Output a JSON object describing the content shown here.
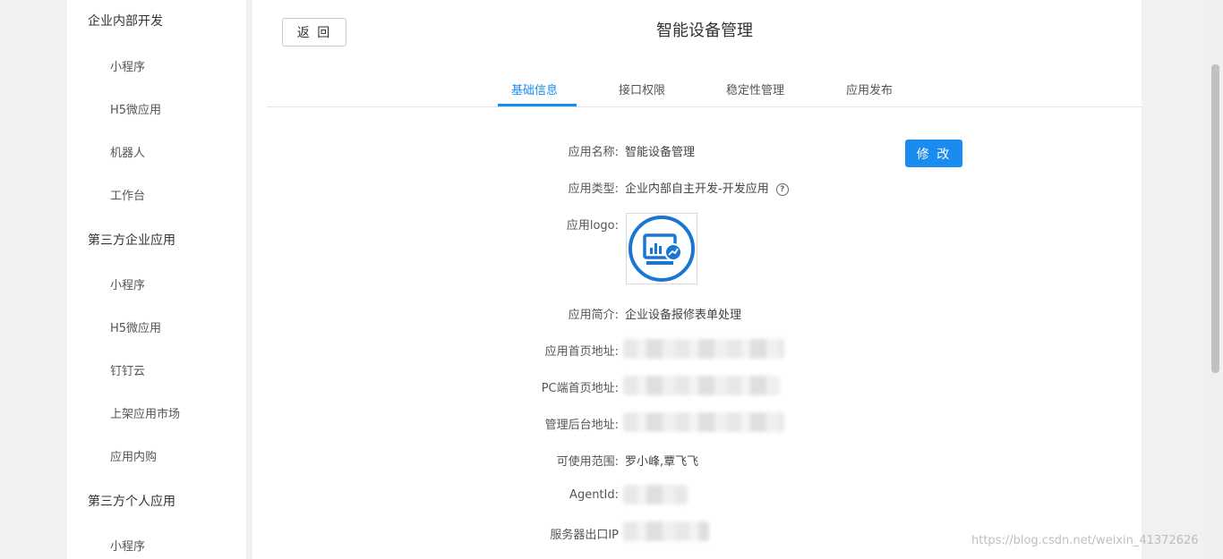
{
  "sidebar": {
    "groups": [
      {
        "label": "企业内部开发",
        "items": [
          "小程序",
          "H5微应用",
          "机器人",
          "工作台"
        ]
      },
      {
        "label": "第三方企业应用",
        "items": [
          "小程序",
          "H5微应用",
          "钉钉云",
          "上架应用市场",
          "应用内购"
        ]
      },
      {
        "label": "第三方个人应用",
        "items": [
          "小程序"
        ]
      }
    ]
  },
  "header": {
    "back_label": "返 回",
    "title": "智能设备管理"
  },
  "tabs": [
    {
      "label": "基础信息",
      "active": true
    },
    {
      "label": "接口权限",
      "active": false
    },
    {
      "label": "稳定性管理",
      "active": false
    },
    {
      "label": "应用发布",
      "active": false
    }
  ],
  "form": {
    "edit_label": "修 改",
    "app_name_label": "应用名称:",
    "app_name": "智能设备管理",
    "app_type_label": "应用类型:",
    "app_type": "企业内部自主开发-开发应用",
    "logo_label": "应用logo:",
    "desc_label": "应用简介:",
    "desc": "企业设备报修表单处理",
    "home_url_label": "应用首页地址:",
    "pc_url_label": "PC端首页地址:",
    "admin_url_label": "管理后台地址:",
    "scope_label": "可使用范围:",
    "scope": "罗小峰,覃飞飞",
    "agentid_label": "AgentId:",
    "server_ip_label": "服务器出口IP"
  },
  "watermark": "https://blog.csdn.net/weixin_41372626",
  "colors": {
    "accent": "#1a8cf0"
  }
}
